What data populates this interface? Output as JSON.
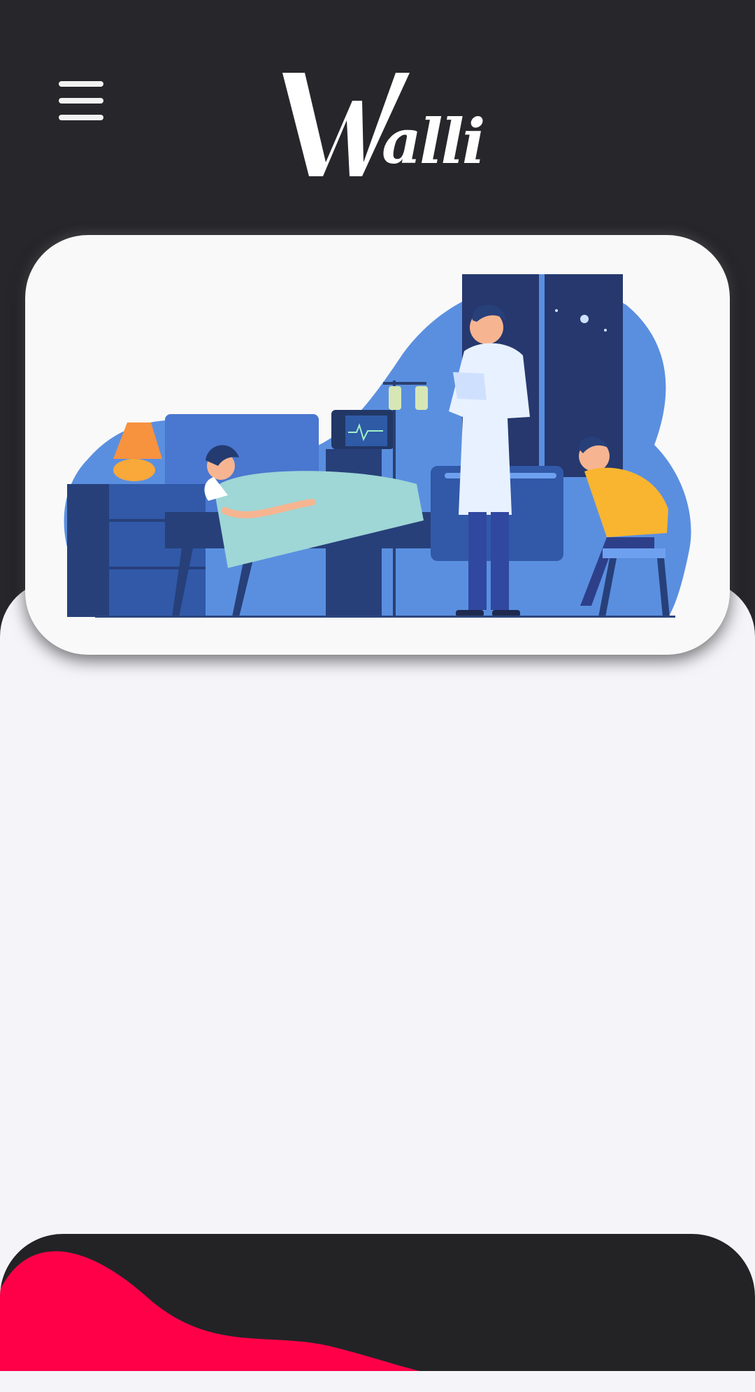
{
  "header": {
    "menu_icon": "hamburger-menu-icon",
    "logo_text": "Walli",
    "logo_initial": "W",
    "logo_rest": "alli"
  },
  "hero": {
    "illustration": "hospital-room-illustration"
  },
  "colors": {
    "background_dark": "#26262b",
    "content_light": "#f4f4f9",
    "card": "#f9f9f9",
    "illustration_blue": "#5a8fe0",
    "footer_dark": "#232326",
    "footer_accent": "#ff0048"
  }
}
